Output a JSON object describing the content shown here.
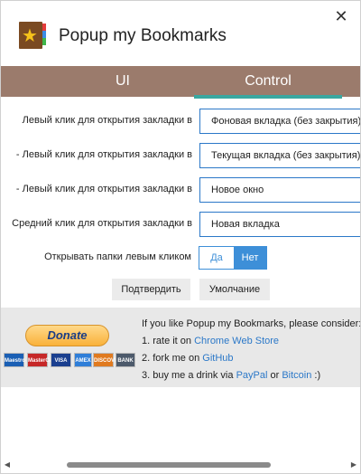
{
  "app": {
    "title": "Popup my Bookmarks",
    "close_icon": "close-icon",
    "logo_icon": "bookmark-star-icon"
  },
  "tabs": [
    {
      "label": "UI",
      "active": false
    },
    {
      "label": "Control",
      "active": true
    }
  ],
  "settings": [
    {
      "label": "Левый клик для открытия закладки в",
      "value": "Фоновая вкладка (без закрытия)"
    },
    {
      "label": "- Левый клик для открытия закладки в",
      "value": "Текущая вкладка (без закрытия)"
    },
    {
      "label": "- Левый клик для открытия закладки в",
      "value": "Новое окно"
    },
    {
      "label": "Средний клик для открытия закладки в",
      "value": "Новая вкладка"
    }
  ],
  "folder_toggle": {
    "label": "Открывать папки левым кликом",
    "yes": "Да",
    "no": "Нет",
    "selected": "Нет"
  },
  "buttons": {
    "confirm": "Подтвердить",
    "default": "Умолчание"
  },
  "donate": {
    "paypal_label": "Donate",
    "cards": [
      "Maestro",
      "MasterCard",
      "VISA",
      "AMEX",
      "DISCOVER",
      "BANK"
    ],
    "intro": "If you like Popup my Bookmarks, please consider:",
    "line1_prefix": "1. rate it on ",
    "line1_link": "Chrome Web Store",
    "line2_prefix": "2. fork me on ",
    "line2_link": "GitHub",
    "line3_prefix": "3. buy me a drink via ",
    "line3_link1": "PayPal",
    "line3_mid": " or ",
    "line3_link2": "Bitcoin",
    "line3_suffix": " :)"
  },
  "colors": {
    "tabbar": "#9b7b6c",
    "tab_underline": "#3aa7a0",
    "accent": "#3d8fd8",
    "link": "#2b78c8"
  }
}
